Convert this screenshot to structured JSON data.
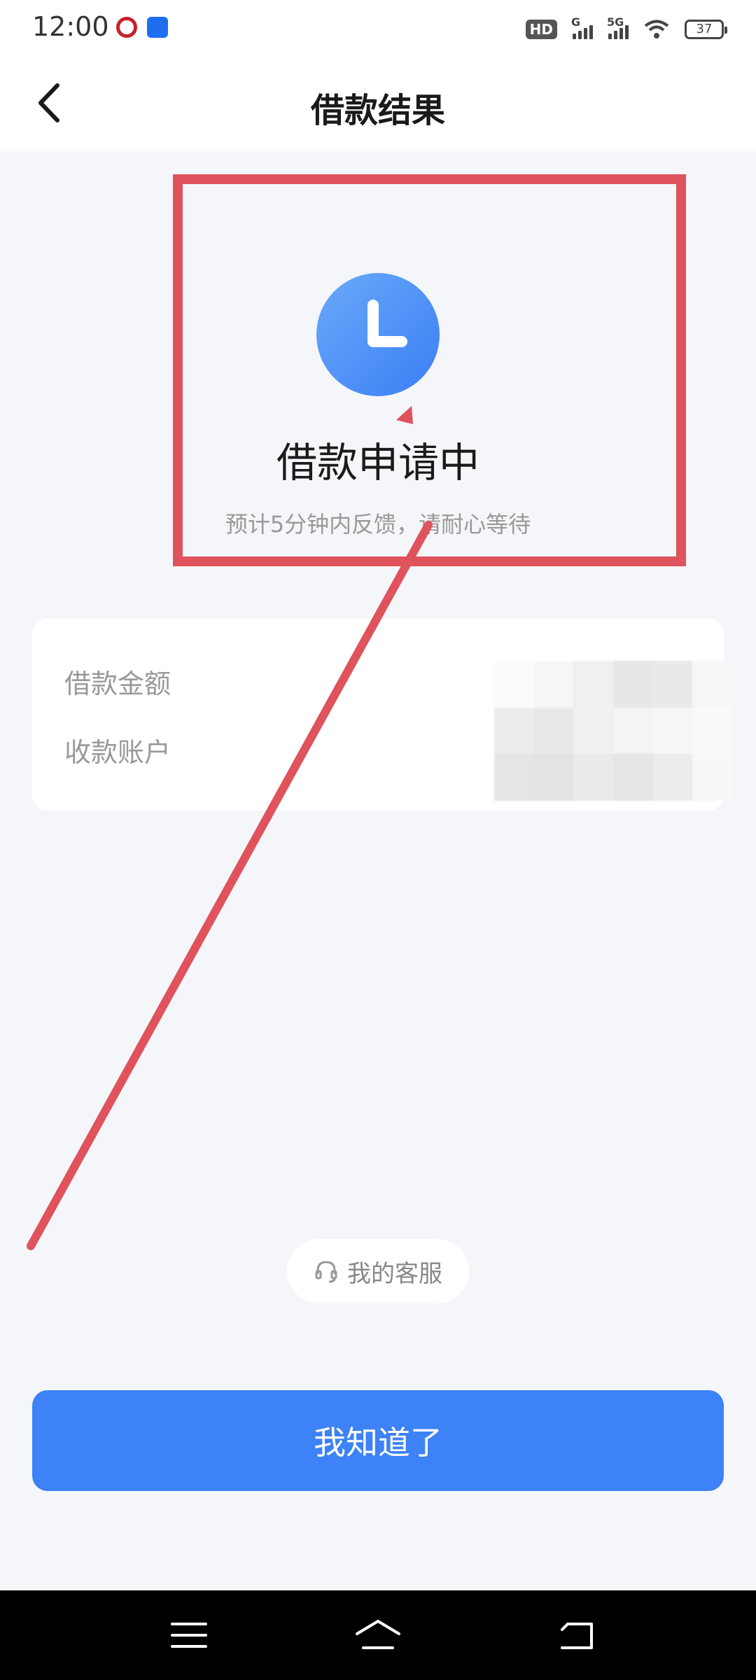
{
  "status_bar": {
    "time": "12:00",
    "battery": "37",
    "hd_label": "HD",
    "network_g": "G",
    "network_5g": "5G"
  },
  "header": {
    "title": "借款结果",
    "back_icon": "chevron-left-icon"
  },
  "result": {
    "icon": "clock-icon",
    "icon_color": "#4d8ff7",
    "title": "借款申请中",
    "subtitle": "预计5分钟内反馈，请耐心等待"
  },
  "info": {
    "amount_label": "借款金额",
    "account_label": "收款账户"
  },
  "service": {
    "icon": "headset-icon",
    "label": "我的客服"
  },
  "confirm_button": {
    "label": "我知道了",
    "color": "#3d82f6"
  },
  "annotation": {
    "color": "#e0525c"
  }
}
